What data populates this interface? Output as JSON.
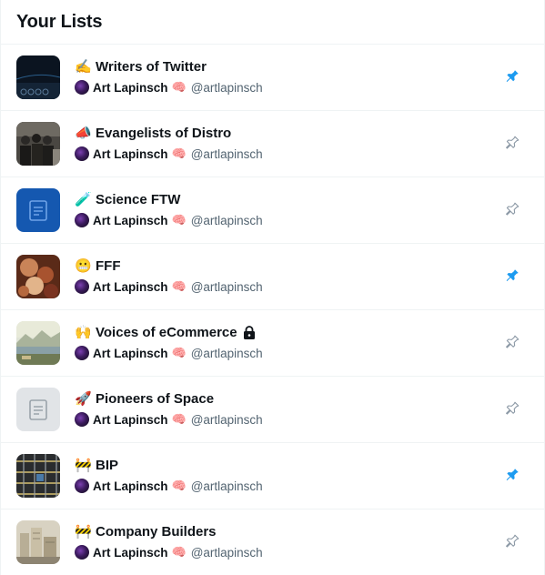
{
  "header": {
    "title": "Your Lists"
  },
  "owner": {
    "name": "Art Lapinsch",
    "badge": "🧠",
    "handle": "@artlapinsch"
  },
  "colors": {
    "pinned": "#1d9bf0",
    "unpinned": "#8b98a5"
  },
  "lists": [
    {
      "emoji": "✍️",
      "name": "Writers of Twitter",
      "pinned": true,
      "locked": false,
      "thumb": "night-dark"
    },
    {
      "emoji": "📣",
      "name": "Evangelists of Distro",
      "pinned": false,
      "locked": false,
      "thumb": "group-photo"
    },
    {
      "emoji": "🧪",
      "name": "Science FTW",
      "pinned": false,
      "locked": false,
      "thumb": "blue-default"
    },
    {
      "emoji": "😬",
      "name": "FFF",
      "pinned": true,
      "locked": false,
      "thumb": "painting-warm"
    },
    {
      "emoji": "🙌",
      "name": "Voices of eCommerce",
      "pinned": false,
      "locked": true,
      "thumb": "landscape"
    },
    {
      "emoji": "🚀",
      "name": "Pioneers of Space",
      "pinned": false,
      "locked": false,
      "thumb": "gray-default"
    },
    {
      "emoji": "🚧",
      "name": "BIP",
      "pinned": true,
      "locked": false,
      "thumb": "scaffold"
    },
    {
      "emoji": "🚧",
      "name": "Company Builders",
      "pinned": false,
      "locked": false,
      "thumb": "city-sketch"
    }
  ]
}
